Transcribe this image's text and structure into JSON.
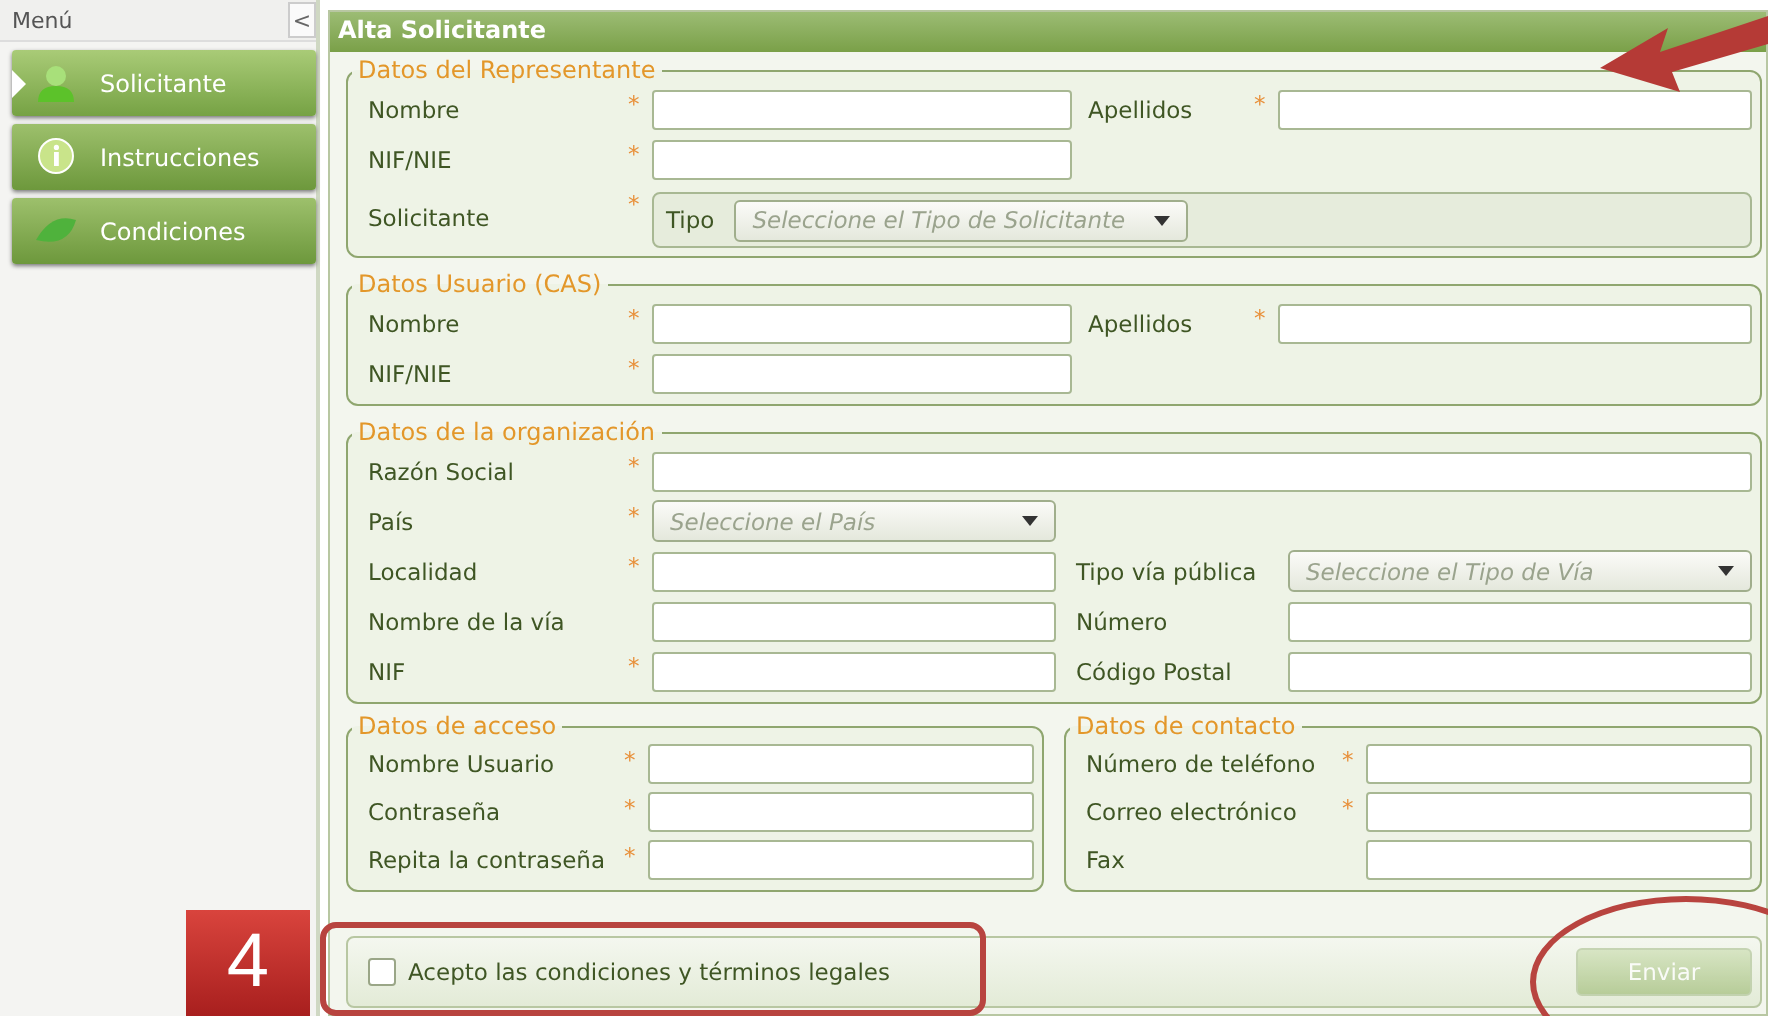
{
  "sidebar": {
    "title": "Menú",
    "collapse": "<",
    "items": [
      {
        "label": "Solicitante",
        "selected": true
      },
      {
        "label": "Instrucciones",
        "selected": false
      },
      {
        "label": "Condiciones",
        "selected": false
      }
    ]
  },
  "panel": {
    "title": "Alta Solicitante"
  },
  "sections": [
    {
      "legend": "Datos del Representante",
      "rows": [
        [
          {
            "label": "Nombre",
            "required_mark": "*",
            "kind": "text"
          },
          {
            "label": "Apellidos",
            "required_mark": "*",
            "kind": "text"
          }
        ],
        [
          {
            "label": "NIF/NIE",
            "required_mark": "*",
            "kind": "text"
          }
        ],
        [
          {
            "label": "Solicitante",
            "required_mark": "*",
            "kind": "tipo",
            "sublabel": "Tipo",
            "placeholder": "Seleccione el Tipo de Solicitante"
          }
        ]
      ]
    },
    {
      "legend": "Datos Usuario (CAS)",
      "rows": [
        [
          {
            "label": "Nombre",
            "required_mark": "*",
            "kind": "text"
          },
          {
            "label": "Apellidos",
            "required_mark": "*",
            "kind": "text"
          }
        ],
        [
          {
            "label": "NIF/NIE",
            "required_mark": "*",
            "kind": "text"
          }
        ]
      ]
    },
    {
      "legend": "Datos de la organización",
      "rows": [
        [
          {
            "label": "Razón Social",
            "required_mark": "*",
            "kind": "wide"
          }
        ],
        [
          {
            "label": "País",
            "required_mark": "*",
            "kind": "select",
            "placeholder": "Seleccione el País"
          }
        ],
        [
          {
            "label": "Localidad",
            "required_mark": "*",
            "kind": "text"
          },
          {
            "label": "Tipo vía pública",
            "kind": "select",
            "placeholder": "Seleccione el Tipo de Vía"
          }
        ],
        [
          {
            "label": "Nombre de la vía",
            "kind": "text"
          },
          {
            "label": "Número",
            "kind": "text"
          }
        ],
        [
          {
            "label": "NIF",
            "required_mark": "*",
            "kind": "text"
          },
          {
            "label": "Código Postal",
            "kind": "text"
          }
        ]
      ]
    }
  ],
  "half_sections": [
    {
      "legend": "Datos de acceso",
      "rows": [
        {
          "label": "Nombre Usuario",
          "required_mark": "*"
        },
        {
          "label": "Contraseña",
          "required_mark": "*"
        },
        {
          "label": "Repita la contraseña",
          "required_mark": "*"
        }
      ]
    },
    {
      "legend": "Datos de contacto",
      "rows": [
        {
          "label": "Número de teléfono",
          "required_mark": "*"
        },
        {
          "label": "Correo electrónico",
          "required_mark": "*"
        },
        {
          "label": "Fax"
        }
      ]
    }
  ],
  "footer": {
    "accept": {
      "label": "Acepto las condiciones y términos legales",
      "checked": false
    },
    "submit": {
      "label": "Enviar",
      "disabled": true
    }
  },
  "annotations": {
    "step": "4"
  }
}
